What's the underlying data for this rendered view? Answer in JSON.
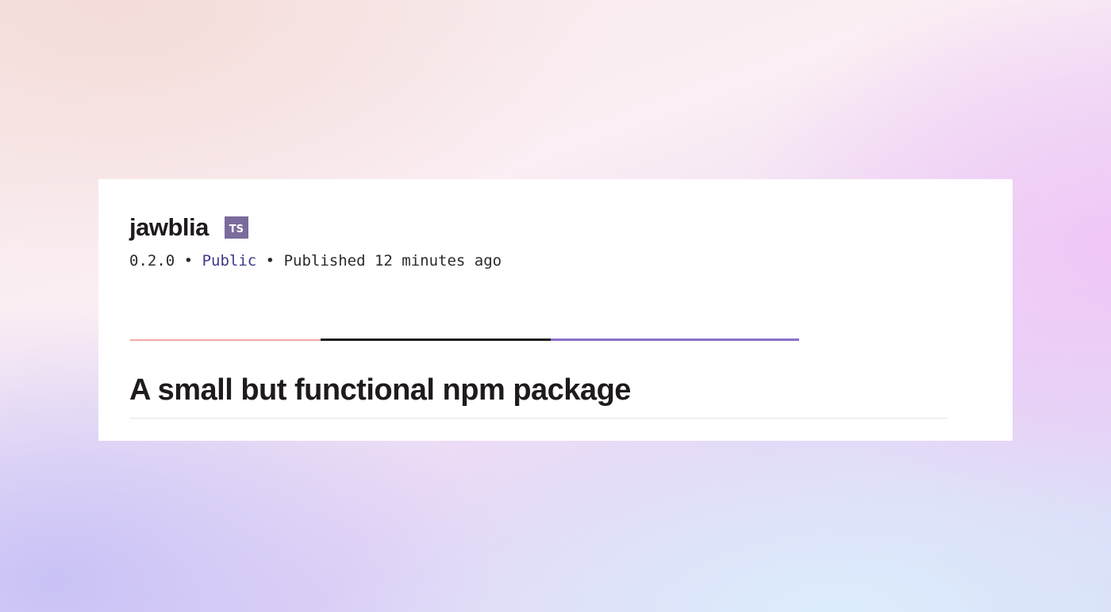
{
  "package": {
    "name": "jawblia",
    "types_badge": "TS",
    "version": "0.2.0",
    "separator": "•",
    "access": "Public",
    "published": "Published 12 minutes ago"
  },
  "tabs": {
    "underline_colors": [
      "#f2a8a4",
      "#1a1a1a",
      "#8a70c8"
    ]
  },
  "readme": {
    "title": "A small but functional npm package"
  },
  "colors": {
    "badge": "#7a6b9c",
    "access_link": "#3c3a8a",
    "text": "#1f1a1d"
  }
}
